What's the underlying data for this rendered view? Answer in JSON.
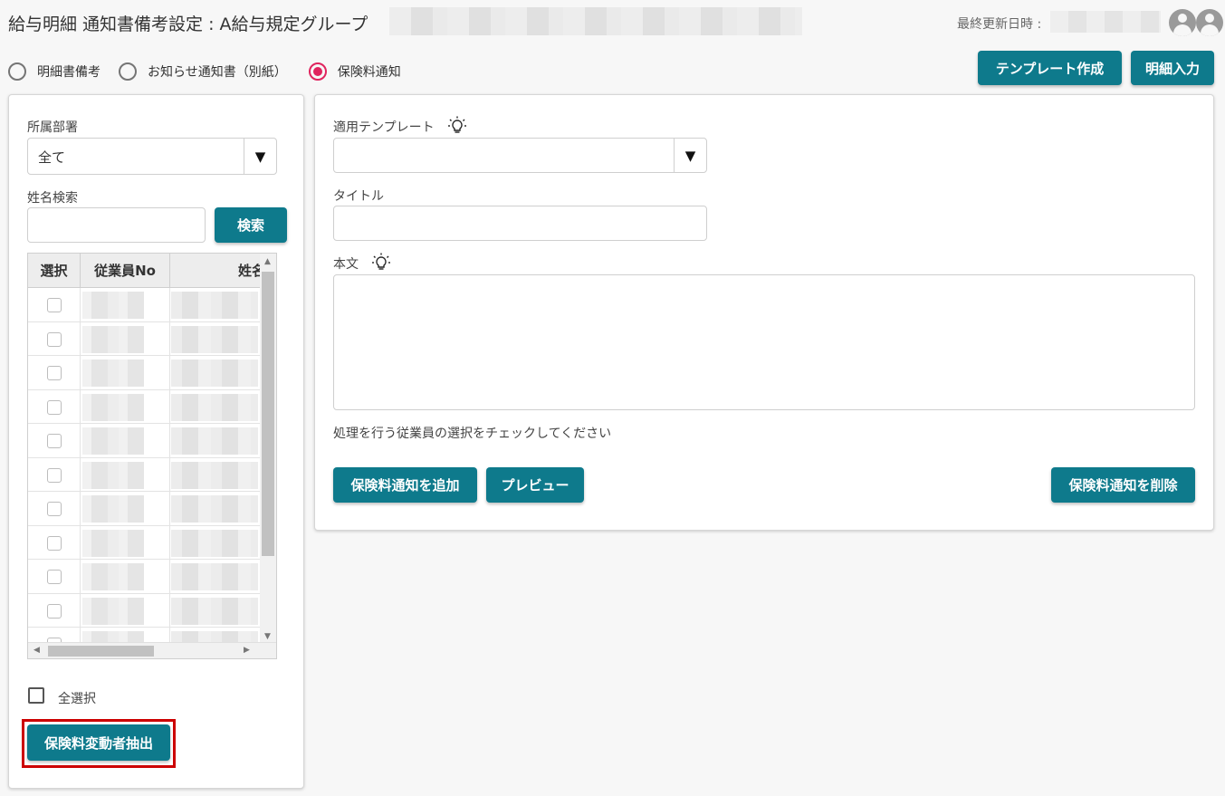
{
  "header": {
    "title": "給与明細 通知書備考設定 : A給与規定グループ",
    "updated_label": "最終更新日時 :"
  },
  "modes": [
    {
      "label": "明細書備考",
      "checked": false
    },
    {
      "label": "お知らせ通知書（別紙）",
      "checked": false
    },
    {
      "label": "保険料通知",
      "checked": true
    }
  ],
  "top_buttons": {
    "template_create": "テンプレート作成",
    "detail_input": "明細入力"
  },
  "left_panel": {
    "department_label": "所属部署",
    "department_value": "全て",
    "name_search_label": "姓名検索",
    "name_search_value": "",
    "search_button": "検索",
    "table": {
      "columns": [
        "選択",
        "従業員No",
        "姓名"
      ],
      "rows_visible": 10
    },
    "select_all_label": "全選択",
    "extract_button": "保険料変動者抽出"
  },
  "right_panel": {
    "template_label": "適用テンプレート",
    "template_value": "",
    "title_label": "タイトル",
    "title_value": "",
    "body_label": "本文",
    "body_value": "",
    "instruction": "処理を行う従業員の選択をチェックしてください",
    "add_button": "保険料通知を追加",
    "preview_button": "プレビュー",
    "delete_button": "保険料通知を削除"
  },
  "colors": {
    "accent": "#0e7a8c",
    "radio_checked": "#e0245e",
    "highlight_border": "#cc0000"
  }
}
